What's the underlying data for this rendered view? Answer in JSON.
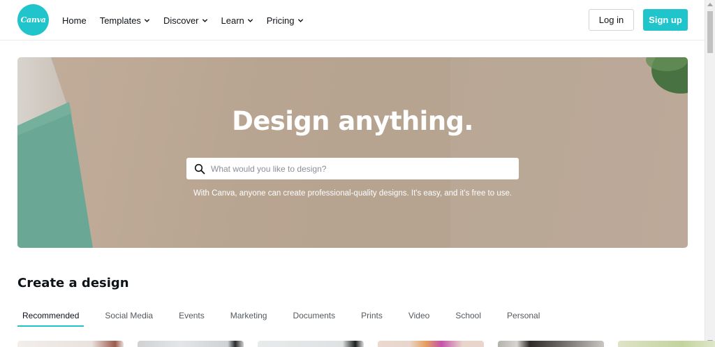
{
  "brand": {
    "logo_text": "Canva",
    "accent_color": "#20c4cb"
  },
  "nav": {
    "items": [
      {
        "label": "Home",
        "dropdown": false
      },
      {
        "label": "Templates",
        "dropdown": true
      },
      {
        "label": "Discover",
        "dropdown": true
      },
      {
        "label": "Learn",
        "dropdown": true
      },
      {
        "label": "Pricing",
        "dropdown": true
      }
    ],
    "login_label": "Log in",
    "signup_label": "Sign up"
  },
  "hero": {
    "title": "Design anything.",
    "search_placeholder": "What would you like to design?",
    "search_value": "",
    "subtitle": "With Canva, anyone can create professional-quality designs. It's easy, and it's free to use."
  },
  "create": {
    "title": "Create a design",
    "tabs": [
      "Recommended",
      "Social Media",
      "Events",
      "Marketing",
      "Documents",
      "Prints",
      "Video",
      "School",
      "Personal"
    ],
    "active_tab": "Recommended",
    "card_colors": [
      "#e9e2de",
      "#cfd1d3",
      "#dfe1e2",
      "#e8d6cc",
      "#b4b1ad",
      "#dfe3c7"
    ]
  }
}
